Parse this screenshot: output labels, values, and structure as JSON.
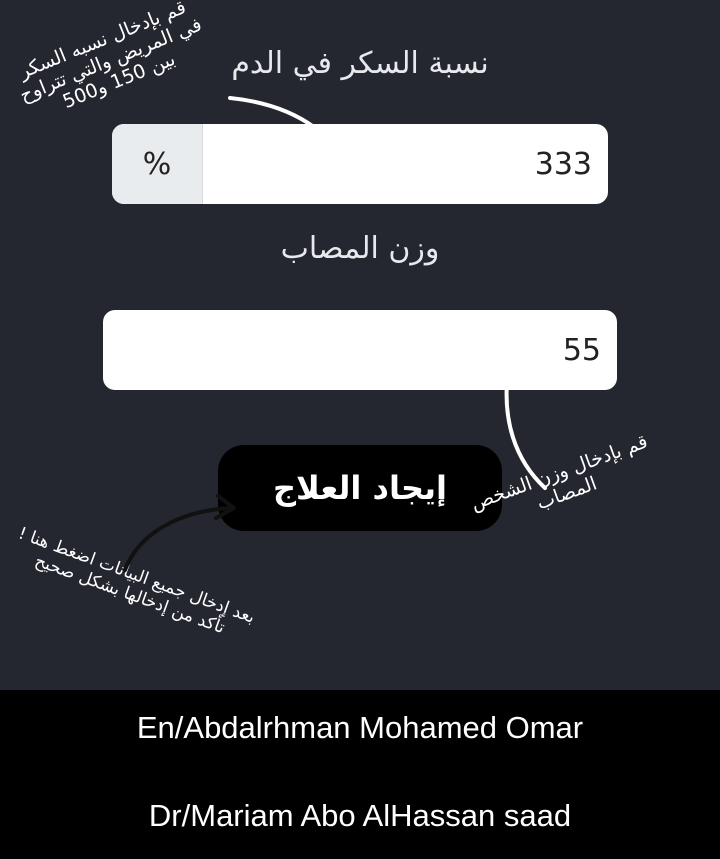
{
  "sugar": {
    "label": "نسبة السكر في الدم",
    "addon": "%",
    "value": "333"
  },
  "weight": {
    "label": "وزن المصاب",
    "value": "55"
  },
  "action": {
    "label": "إيجاد العلاج"
  },
  "notes": {
    "sugar_hint": [
      "قم بإدخال نسبه السكر",
      "في المريض والتي تتراوح",
      "بين 150 و500"
    ],
    "weight_hint": [
      "قم بإدخال وزن الشخص",
      "المصاب"
    ],
    "submit_hint": [
      "بعد إدخال جميع البيانات اضغط هنا !",
      "تأكد من إدخالها بشكل صحيح"
    ]
  },
  "footer": {
    "line1": "En/Abdalrhman Mohamed Omar",
    "line2": "Dr/Mariam Abo AlHassan saad"
  }
}
